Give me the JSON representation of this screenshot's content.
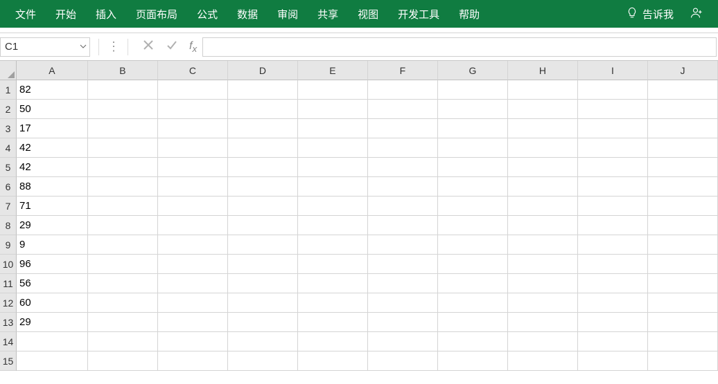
{
  "ribbon": {
    "tabs": [
      "文件",
      "开始",
      "插入",
      "页面布局",
      "公式",
      "数据",
      "审阅",
      "共享",
      "视图",
      "开发工具",
      "帮助"
    ],
    "tell_me": "告诉我"
  },
  "formula_bar": {
    "name_box": "C1",
    "formula": ""
  },
  "grid": {
    "columns": [
      "A",
      "B",
      "C",
      "D",
      "E",
      "F",
      "G",
      "H",
      "I",
      "J"
    ],
    "row_count": 15,
    "cells": {
      "A1": "82",
      "A2": "50",
      "A3": "17",
      "A4": "42",
      "A5": "42",
      "A6": "88",
      "A7": "71",
      "A8": "29",
      "A9": "9",
      "A10": "96",
      "A11": "56",
      "A12": "60",
      "A13": "29"
    }
  }
}
